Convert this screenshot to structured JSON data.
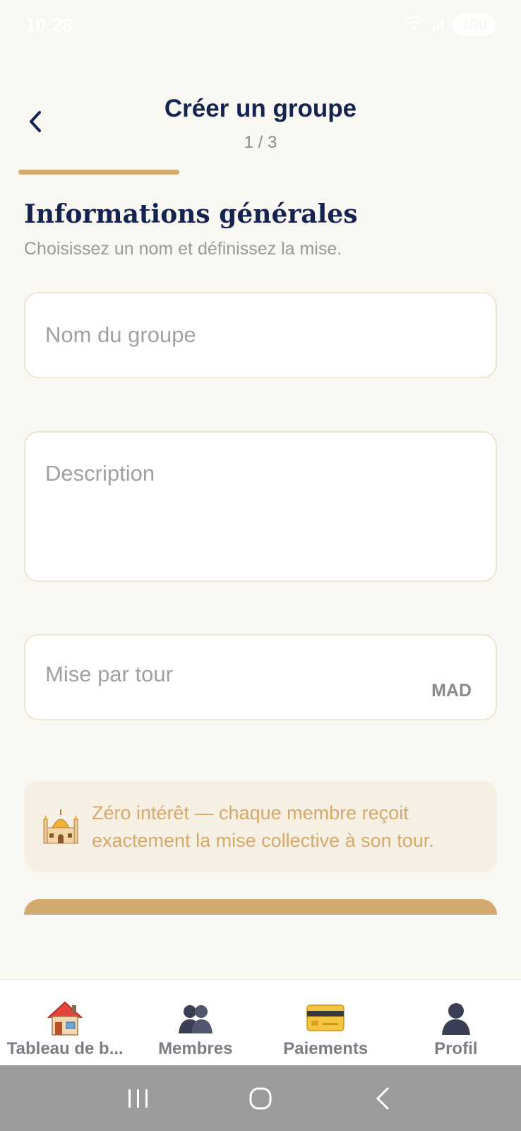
{
  "status_bar": {
    "time": "10:28",
    "battery": "100"
  },
  "header": {
    "title": "Créer un groupe",
    "step": "1 / 3"
  },
  "progress": {
    "fraction": 0.333
  },
  "section": {
    "title": "Informations générales",
    "subtitle": "Choisissez un nom et définissez la mise."
  },
  "form": {
    "name_placeholder": "Nom du groupe",
    "description_placeholder": "Description",
    "stake_placeholder": "Mise par tour",
    "currency": "MAD"
  },
  "info": {
    "icon": "mosque-icon",
    "line1": "Zéro intérêt — chaque membre reçoit",
    "line2": "exactement la mise collective à son tour."
  },
  "tabs": [
    {
      "label": "Tableau de b...",
      "icon": "house-icon"
    },
    {
      "label": "Membres",
      "icon": "members-icon"
    },
    {
      "label": "Paiements",
      "icon": "credit-card-icon"
    },
    {
      "label": "Profil",
      "icon": "profile-icon"
    }
  ],
  "colors": {
    "accent": "#d2a96f",
    "navy": "#142350",
    "background": "#f9f7f2",
    "info_background": "#f6efe3"
  }
}
